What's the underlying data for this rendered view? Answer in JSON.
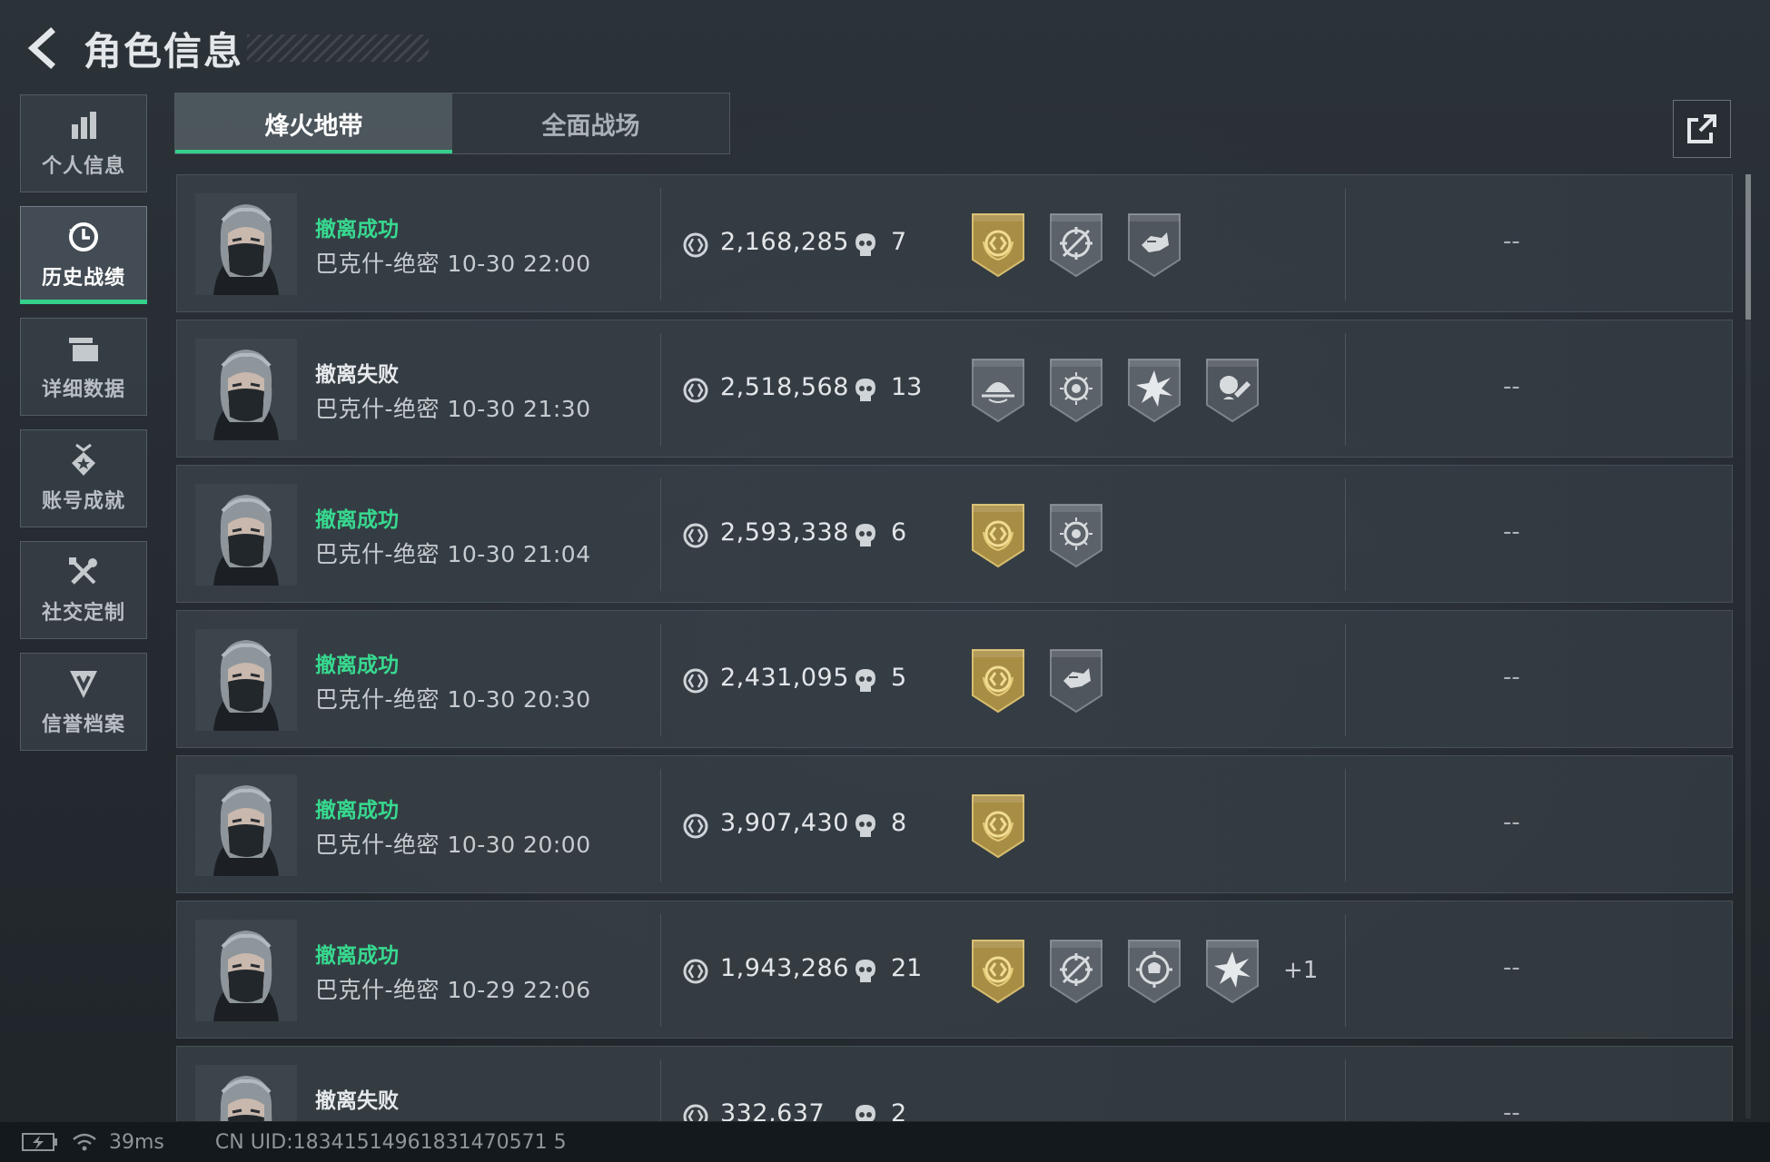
{
  "header": {
    "title": "角色信息"
  },
  "sidebar": {
    "items": [
      {
        "label": "个人信息",
        "icon": "bar-chart-icon"
      },
      {
        "label": "历史战绩",
        "icon": "clock-icon"
      },
      {
        "label": "详细数据",
        "icon": "folder-icon"
      },
      {
        "label": "账号成就",
        "icon": "medal-icon"
      },
      {
        "label": "社交定制",
        "icon": "tools-icon"
      },
      {
        "label": "信誉档案",
        "icon": "shield-down-icon"
      }
    ],
    "active_index": 1
  },
  "tabs": [
    {
      "label": "烽火地带",
      "active": true
    },
    {
      "label": "全面战场",
      "active": false
    }
  ],
  "matches": [
    {
      "status": "撤离成功",
      "success": true,
      "map_time": "巴克什-绝密 10-30 22:00",
      "value": "2,168,285",
      "kills": "7",
      "badges": [
        "gold-extract",
        "crosshair-compass",
        "running-arm"
      ],
      "extra": "",
      "result": "--"
    },
    {
      "status": "撤离失败",
      "success": false,
      "map_time": "巴克什-绝密 10-30 21:30",
      "value": "2,518,568",
      "kills": "13",
      "badges": [
        "dome-crest",
        "target-sun",
        "burst-star",
        "soldier-head"
      ],
      "extra": "",
      "result": "--"
    },
    {
      "status": "撤离成功",
      "success": true,
      "map_time": "巴克什-绝密 10-30 21:04",
      "value": "2,593,338",
      "kills": "6",
      "badges": [
        "gold-extract",
        "target-sun"
      ],
      "extra": "",
      "result": "--"
    },
    {
      "status": "撤离成功",
      "success": true,
      "map_time": "巴克什-绝密 10-30 20:30",
      "value": "2,431,095",
      "kills": "5",
      "badges": [
        "gold-extract",
        "running-arm"
      ],
      "extra": "",
      "result": "--"
    },
    {
      "status": "撤离成功",
      "success": true,
      "map_time": "巴克什-绝密 10-30 20:00",
      "value": "3,907,430",
      "kills": "8",
      "badges": [
        "gold-extract"
      ],
      "extra": "",
      "result": "--"
    },
    {
      "status": "撤离成功",
      "success": true,
      "map_time": "巴克什-绝密 10-29 22:06",
      "value": "1,943,286",
      "kills": "21",
      "badges": [
        "gold-extract",
        "crosshair-compass",
        "skull-target",
        "burst-star"
      ],
      "extra": "+1",
      "result": "--"
    },
    {
      "status": "撤离失败",
      "success": false,
      "map_time": "",
      "value": "332,637",
      "kills": "2",
      "badges": [],
      "extra": "",
      "result": "--"
    }
  ],
  "footer": {
    "ping": "39ms",
    "uid": "CN UID:18341514961831470571 5"
  },
  "colors": {
    "accent_green": "#35d08c",
    "success_text": "#37d98f",
    "gold_badge": "#b39a52",
    "gray_badge": "#5a6168"
  }
}
